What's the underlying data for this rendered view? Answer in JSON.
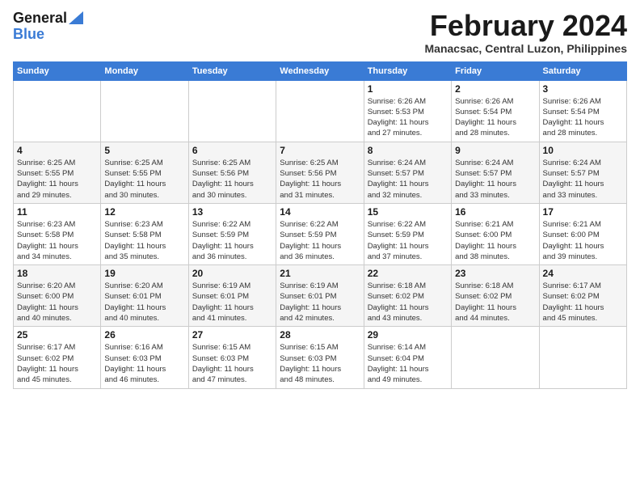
{
  "logo": {
    "line1": "General",
    "line2": "Blue"
  },
  "header": {
    "title": "February 2024",
    "location": "Manacsac, Central Luzon, Philippines"
  },
  "weekdays": [
    "Sunday",
    "Monday",
    "Tuesday",
    "Wednesday",
    "Thursday",
    "Friday",
    "Saturday"
  ],
  "weeks": [
    [
      {
        "day": "",
        "info": ""
      },
      {
        "day": "",
        "info": ""
      },
      {
        "day": "",
        "info": ""
      },
      {
        "day": "",
        "info": ""
      },
      {
        "day": "1",
        "info": "Sunrise: 6:26 AM\nSunset: 5:53 PM\nDaylight: 11 hours\nand 27 minutes."
      },
      {
        "day": "2",
        "info": "Sunrise: 6:26 AM\nSunset: 5:54 PM\nDaylight: 11 hours\nand 28 minutes."
      },
      {
        "day": "3",
        "info": "Sunrise: 6:26 AM\nSunset: 5:54 PM\nDaylight: 11 hours\nand 28 minutes."
      }
    ],
    [
      {
        "day": "4",
        "info": "Sunrise: 6:25 AM\nSunset: 5:55 PM\nDaylight: 11 hours\nand 29 minutes."
      },
      {
        "day": "5",
        "info": "Sunrise: 6:25 AM\nSunset: 5:55 PM\nDaylight: 11 hours\nand 30 minutes."
      },
      {
        "day": "6",
        "info": "Sunrise: 6:25 AM\nSunset: 5:56 PM\nDaylight: 11 hours\nand 30 minutes."
      },
      {
        "day": "7",
        "info": "Sunrise: 6:25 AM\nSunset: 5:56 PM\nDaylight: 11 hours\nand 31 minutes."
      },
      {
        "day": "8",
        "info": "Sunrise: 6:24 AM\nSunset: 5:57 PM\nDaylight: 11 hours\nand 32 minutes."
      },
      {
        "day": "9",
        "info": "Sunrise: 6:24 AM\nSunset: 5:57 PM\nDaylight: 11 hours\nand 33 minutes."
      },
      {
        "day": "10",
        "info": "Sunrise: 6:24 AM\nSunset: 5:57 PM\nDaylight: 11 hours\nand 33 minutes."
      }
    ],
    [
      {
        "day": "11",
        "info": "Sunrise: 6:23 AM\nSunset: 5:58 PM\nDaylight: 11 hours\nand 34 minutes."
      },
      {
        "day": "12",
        "info": "Sunrise: 6:23 AM\nSunset: 5:58 PM\nDaylight: 11 hours\nand 35 minutes."
      },
      {
        "day": "13",
        "info": "Sunrise: 6:22 AM\nSunset: 5:59 PM\nDaylight: 11 hours\nand 36 minutes."
      },
      {
        "day": "14",
        "info": "Sunrise: 6:22 AM\nSunset: 5:59 PM\nDaylight: 11 hours\nand 36 minutes."
      },
      {
        "day": "15",
        "info": "Sunrise: 6:22 AM\nSunset: 5:59 PM\nDaylight: 11 hours\nand 37 minutes."
      },
      {
        "day": "16",
        "info": "Sunrise: 6:21 AM\nSunset: 6:00 PM\nDaylight: 11 hours\nand 38 minutes."
      },
      {
        "day": "17",
        "info": "Sunrise: 6:21 AM\nSunset: 6:00 PM\nDaylight: 11 hours\nand 39 minutes."
      }
    ],
    [
      {
        "day": "18",
        "info": "Sunrise: 6:20 AM\nSunset: 6:00 PM\nDaylight: 11 hours\nand 40 minutes."
      },
      {
        "day": "19",
        "info": "Sunrise: 6:20 AM\nSunset: 6:01 PM\nDaylight: 11 hours\nand 40 minutes."
      },
      {
        "day": "20",
        "info": "Sunrise: 6:19 AM\nSunset: 6:01 PM\nDaylight: 11 hours\nand 41 minutes."
      },
      {
        "day": "21",
        "info": "Sunrise: 6:19 AM\nSunset: 6:01 PM\nDaylight: 11 hours\nand 42 minutes."
      },
      {
        "day": "22",
        "info": "Sunrise: 6:18 AM\nSunset: 6:02 PM\nDaylight: 11 hours\nand 43 minutes."
      },
      {
        "day": "23",
        "info": "Sunrise: 6:18 AM\nSunset: 6:02 PM\nDaylight: 11 hours\nand 44 minutes."
      },
      {
        "day": "24",
        "info": "Sunrise: 6:17 AM\nSunset: 6:02 PM\nDaylight: 11 hours\nand 45 minutes."
      }
    ],
    [
      {
        "day": "25",
        "info": "Sunrise: 6:17 AM\nSunset: 6:02 PM\nDaylight: 11 hours\nand 45 minutes."
      },
      {
        "day": "26",
        "info": "Sunrise: 6:16 AM\nSunset: 6:03 PM\nDaylight: 11 hours\nand 46 minutes."
      },
      {
        "day": "27",
        "info": "Sunrise: 6:15 AM\nSunset: 6:03 PM\nDaylight: 11 hours\nand 47 minutes."
      },
      {
        "day": "28",
        "info": "Sunrise: 6:15 AM\nSunset: 6:03 PM\nDaylight: 11 hours\nand 48 minutes."
      },
      {
        "day": "29",
        "info": "Sunrise: 6:14 AM\nSunset: 6:04 PM\nDaylight: 11 hours\nand 49 minutes."
      },
      {
        "day": "",
        "info": ""
      },
      {
        "day": "",
        "info": ""
      }
    ]
  ]
}
